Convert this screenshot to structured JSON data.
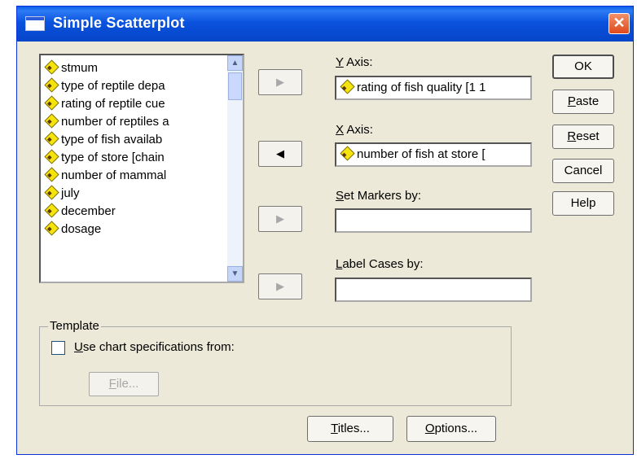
{
  "window": {
    "title": "Simple Scatterplot",
    "close_label": "✕"
  },
  "variables": [
    "stmum",
    "type of reptile depa",
    "rating of reptile cue",
    "number of reptiles a",
    "type of fish availab",
    "type of store [chain",
    "number of mammal",
    "july",
    "december",
    "dosage"
  ],
  "fields": {
    "y_axis": {
      "label_key": "Y",
      "label_rest": " Axis:",
      "value": "rating of fish quality [1 1"
    },
    "x_axis": {
      "label_key": "X",
      "label_rest": " Axis:",
      "value": "number of fish at store ["
    },
    "set_markers": {
      "label_key": "S",
      "label_rest": "et Markers by:",
      "value": ""
    },
    "label_cases": {
      "label_key": "L",
      "label_rest": "abel Cases by:",
      "value": ""
    }
  },
  "transfer_arrows": {
    "y": "▶",
    "x": "◀",
    "markers": "▶",
    "labels": "▶"
  },
  "buttons": {
    "ok": "OK",
    "paste_key": "P",
    "paste_rest": "aste",
    "reset_key": "R",
    "reset_rest": "eset",
    "cancel": "Cancel",
    "help": "Help"
  },
  "template": {
    "legend": "Template",
    "checkbox_key": "U",
    "checkbox_rest": "se chart specifications from:",
    "checked": false,
    "file_key": "F",
    "file_rest": "ile..."
  },
  "bottom": {
    "titles_key": "T",
    "titles_rest": "itles...",
    "options_key": "O",
    "options_rest": "ptions..."
  },
  "colors": {
    "titlebar": "#0a52de",
    "dialog_bg": "#ece9d8",
    "close_button": "#e04a1c",
    "variable_icon": "#f5e30c"
  }
}
